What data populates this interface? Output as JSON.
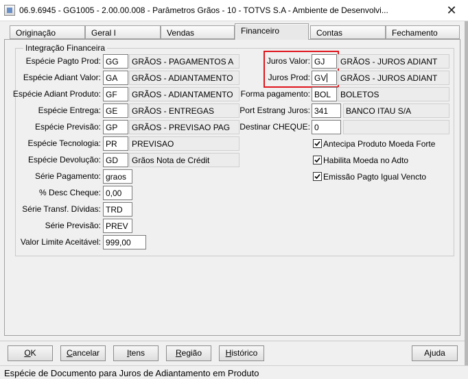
{
  "window": {
    "title": "06.9.6945 - GG1005 - 2.00.00.008 - Parâmetros Grãos - 10 - TOTVS S.A - Ambiente de Desenvolvi...",
    "close_glyph": "✕"
  },
  "tabs": [
    {
      "label": "Originação",
      "active": false
    },
    {
      "label": "Geral I",
      "active": false
    },
    {
      "label": "Vendas",
      "active": false
    },
    {
      "label": "Financeiro",
      "active": true
    },
    {
      "label": "Contas",
      "active": false
    },
    {
      "label": "Fechamento",
      "active": false
    }
  ],
  "group": {
    "title": "Integração Financeira"
  },
  "left_fields": [
    {
      "label": "Espécie Pagto Prod:",
      "value": "GG",
      "desc": "GRÃOS - PAGAMENTOS A"
    },
    {
      "label": "Espécie Adiant Valor:",
      "value": "GA",
      "desc": "GRÃOS - ADIANTAMENTO"
    },
    {
      "label": "Espécie Adiant Produto:",
      "value": "GF",
      "desc": "GRÃOS - ADIANTAMENTO"
    },
    {
      "label": "Espécie Entrega:",
      "value": "GE",
      "desc": "GRÃOS - ENTREGAS"
    },
    {
      "label": "Espécie Previsão:",
      "value": "GP",
      "desc": "GRÃOS - PREVISAO PAG"
    },
    {
      "label": "Espécie Tecnologia:",
      "value": "PR",
      "desc": "PREVISAO"
    },
    {
      "label": "Espécie Devolução:",
      "value": "GD",
      "desc": "Grãos Nota de Crédit"
    },
    {
      "label": "Série Pagamento:",
      "value": "graos"
    },
    {
      "label": "% Desc Cheque:",
      "value": "0,00"
    },
    {
      "label": "Série Transf. Dívidas:",
      "value": "TRD"
    },
    {
      "label": "Série Previsão:",
      "value": "PREV"
    },
    {
      "label": "Valor Limite Aceitável:",
      "value": "999,00"
    }
  ],
  "right_fields": [
    {
      "label": "Juros Valor:",
      "value": "GJ",
      "desc": "GRÃOS - JUROS ADIANT"
    },
    {
      "label": "Juros Prod:",
      "value": "GV",
      "desc": "GRÃOS - JUROS ADIANT"
    },
    {
      "label": "Forma pagamento:",
      "value": "BOL",
      "desc": "BOLETOS"
    },
    {
      "label": "Port Estrang Juros:",
      "value": "341",
      "desc": "BANCO ITAU S/A"
    },
    {
      "label": "Destinar CHEQUE:",
      "value": "0",
      "desc": ""
    }
  ],
  "checkboxes": [
    {
      "label": "Antecipa Produto Moeda Forte",
      "checked": true
    },
    {
      "label": "Habilita Moeda no Adto",
      "checked": true
    },
    {
      "label": "Emissão Pagto Igual Vencto",
      "checked": true
    }
  ],
  "buttons": {
    "ok": {
      "hot": "O",
      "rest": "K"
    },
    "cancelar": {
      "hot": "C",
      "rest": "ancelar"
    },
    "itens": {
      "hot": "I",
      "rest": "tens"
    },
    "regiao": {
      "hot": "R",
      "rest": "egião"
    },
    "historico": {
      "hot": "H",
      "rest": "istórico"
    },
    "ajuda": {
      "pre": "A",
      "hot": "j",
      "rest": "uda"
    }
  },
  "status": {
    "text": "Espécie de Documento para Juros de Adiantamento em Produto"
  },
  "colors": {
    "highlight": "#e0141b"
  }
}
